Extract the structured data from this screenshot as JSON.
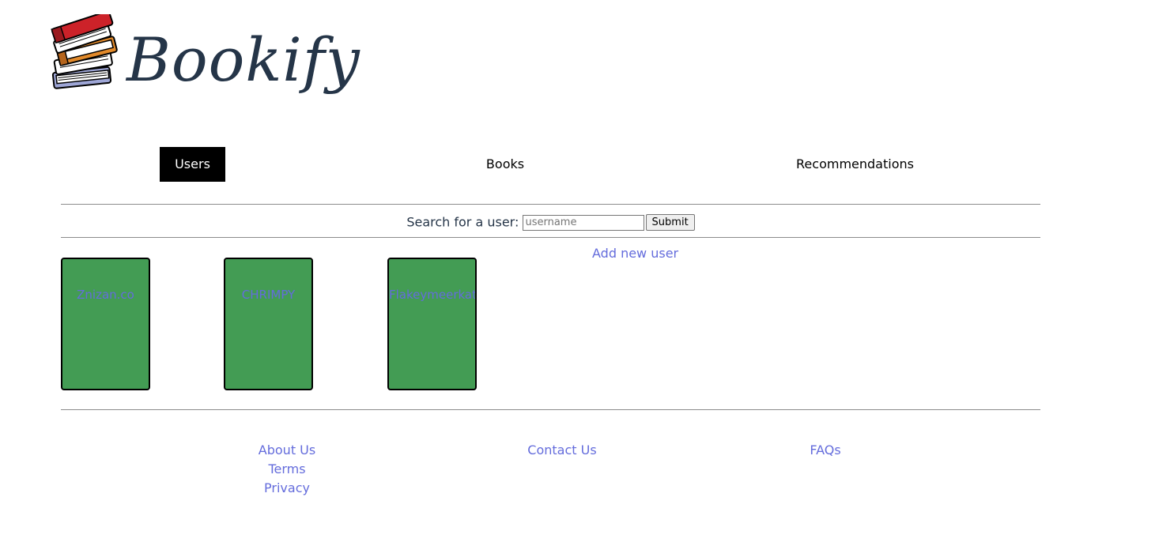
{
  "logo": {
    "title": "Bookify",
    "icon": "stack-of-books-icon"
  },
  "nav": {
    "items": [
      {
        "label": "Users",
        "active": true
      },
      {
        "label": "Books",
        "active": false
      },
      {
        "label": "Recommendations",
        "active": false
      }
    ]
  },
  "search": {
    "label": "Search for a user:",
    "placeholder": "username",
    "value": "",
    "submit_label": "Submit"
  },
  "add_user": {
    "label": "Add new user"
  },
  "users": [
    {
      "name": "Znizan.co"
    },
    {
      "name": "CHRIMPY"
    },
    {
      "name": "Flakeymeerkat"
    }
  ],
  "footer": {
    "links": [
      {
        "label": "About Us"
      },
      {
        "label": "Terms"
      },
      {
        "label": "Privacy"
      },
      {
        "label": "Contact Us"
      },
      {
        "label": "FAQs"
      }
    ]
  },
  "colors": {
    "card_green": "#439c54",
    "link_blue": "#646cdc",
    "logo_navy": "#253548",
    "nav_active_bg": "#000000"
  }
}
